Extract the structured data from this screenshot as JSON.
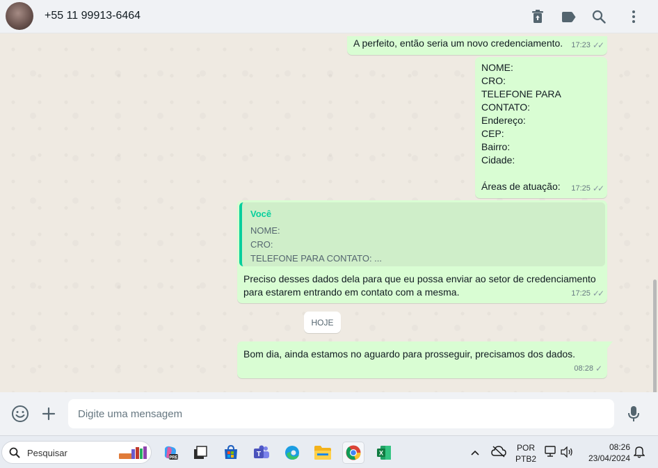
{
  "header": {
    "contact_name": "+55 11 99913-6464",
    "icons": [
      "trash-icon",
      "label-icon",
      "search-icon",
      "menu-icon"
    ]
  },
  "messages": [
    {
      "text": "A perfeito, então seria um novo credenciamento.",
      "time": "17:23",
      "status": "read"
    },
    {
      "lines": [
        "NOME:",
        "CRO:",
        "TELEFONE PARA CONTATO:",
        "",
        "Endereço:",
        "CEP:",
        "Bairro:",
        "Cidade:",
        "",
        "Áreas de atuação:"
      ],
      "time": "17:25",
      "status": "read"
    },
    {
      "quote": {
        "author": "Você",
        "lines": [
          "NOME:",
          "CRO:",
          "TELEFONE PARA CONTATO: ..."
        ]
      },
      "text_line1": "Preciso desses dados dela para que eu possa enviar ao setor de credenciamento",
      "text_line2": "para estarem entrando em contato com a mesma.",
      "time": "17:25",
      "status": "read"
    },
    {
      "text": "Bom dia, ainda estamos no aguardo para prosseguir, precisamos dos dados.",
      "time": "08:28",
      "status": "sent"
    }
  ],
  "day_separator": "HOJE",
  "composer": {
    "placeholder": "Digite uma mensagem",
    "icons": [
      "emoji-icon",
      "plus-icon",
      "microphone-icon"
    ]
  },
  "taskbar": {
    "search_placeholder": "Pesquisar",
    "apps": [
      "copilot-icon",
      "app-icon",
      "store-icon",
      "teams-icon",
      "edge-icon",
      "file-explorer-icon",
      "chrome-icon",
      "excel-icon"
    ],
    "language_line1": "POR",
    "language_line2": "PTB2",
    "time": "08:26",
    "date": "23/04/2024"
  },
  "colors": {
    "outgoing_bubble": "#d9fdd3",
    "quote_accent": "#06cf9c",
    "header_bg": "#f0f2f5",
    "chat_bg": "#efeae2"
  }
}
